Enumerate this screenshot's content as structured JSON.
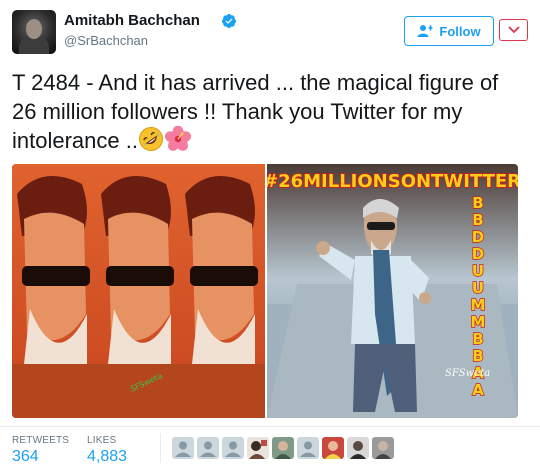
{
  "header": {
    "display_name": "Amitabh Bachchan",
    "handle": "@SrBachchan",
    "follow_label": "Follow"
  },
  "tweet": {
    "text": "T 2484 - And it has arrived ... the magical figure of 26 million followers !! Thank you Twitter for my intolerance ..",
    "emojis": [
      "rolling-on-floor-laughing-emoji",
      "hibiscus-emoji"
    ]
  },
  "media": {
    "right_image_banner": "#26MILLIONSONTWITTER",
    "right_image_vertical_text": "BBDDUUMMBBAA",
    "right_image_watermark": "SFSweta",
    "left_image_watermark": "SFSweta"
  },
  "stats": {
    "retweets_label": "RETWEETS",
    "retweets_value": "364",
    "likes_label": "LIKES",
    "likes_value": "4,883"
  },
  "likers": [
    {
      "kind": "default-avatar"
    },
    {
      "kind": "default-avatar"
    },
    {
      "kind": "default-avatar"
    },
    {
      "kind": "photo-avatar"
    },
    {
      "kind": "photo-avatar"
    },
    {
      "kind": "default-avatar"
    },
    {
      "kind": "photo-avatar"
    },
    {
      "kind": "photo-avatar"
    },
    {
      "kind": "photo-avatar"
    }
  ],
  "colors": {
    "accent": "#1da1f2",
    "verified": "#1da1f2",
    "caret_border": "#d8384a"
  }
}
